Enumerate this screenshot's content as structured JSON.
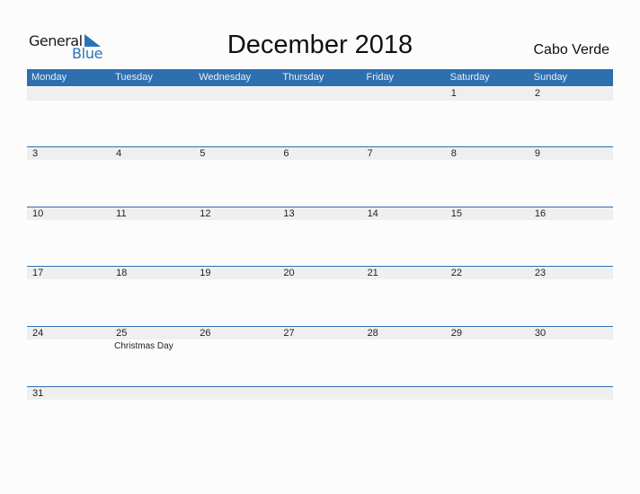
{
  "logo": {
    "line1": "General",
    "line2": "Blue"
  },
  "title": "December 2018",
  "country": "Cabo Verde",
  "colors": {
    "accent": "#2e6fb0",
    "strip": "#efefef"
  },
  "weekdays": [
    "Monday",
    "Tuesday",
    "Wednesday",
    "Thursday",
    "Friday",
    "Saturday",
    "Sunday"
  ],
  "weeks": [
    [
      {
        "day": ""
      },
      {
        "day": ""
      },
      {
        "day": ""
      },
      {
        "day": ""
      },
      {
        "day": ""
      },
      {
        "day": "1"
      },
      {
        "day": "2"
      }
    ],
    [
      {
        "day": "3"
      },
      {
        "day": "4"
      },
      {
        "day": "5"
      },
      {
        "day": "6"
      },
      {
        "day": "7"
      },
      {
        "day": "8"
      },
      {
        "day": "9"
      }
    ],
    [
      {
        "day": "10"
      },
      {
        "day": "11"
      },
      {
        "day": "12"
      },
      {
        "day": "13"
      },
      {
        "day": "14"
      },
      {
        "day": "15"
      },
      {
        "day": "16"
      }
    ],
    [
      {
        "day": "17"
      },
      {
        "day": "18"
      },
      {
        "day": "19"
      },
      {
        "day": "20"
      },
      {
        "day": "21"
      },
      {
        "day": "22"
      },
      {
        "day": "23"
      }
    ],
    [
      {
        "day": "24"
      },
      {
        "day": "25",
        "event": "Christmas Day"
      },
      {
        "day": "26"
      },
      {
        "day": "27"
      },
      {
        "day": "28"
      },
      {
        "day": "29"
      },
      {
        "day": "30"
      }
    ],
    [
      {
        "day": "31"
      },
      {
        "day": ""
      },
      {
        "day": ""
      },
      {
        "day": ""
      },
      {
        "day": ""
      },
      {
        "day": ""
      },
      {
        "day": ""
      }
    ]
  ]
}
